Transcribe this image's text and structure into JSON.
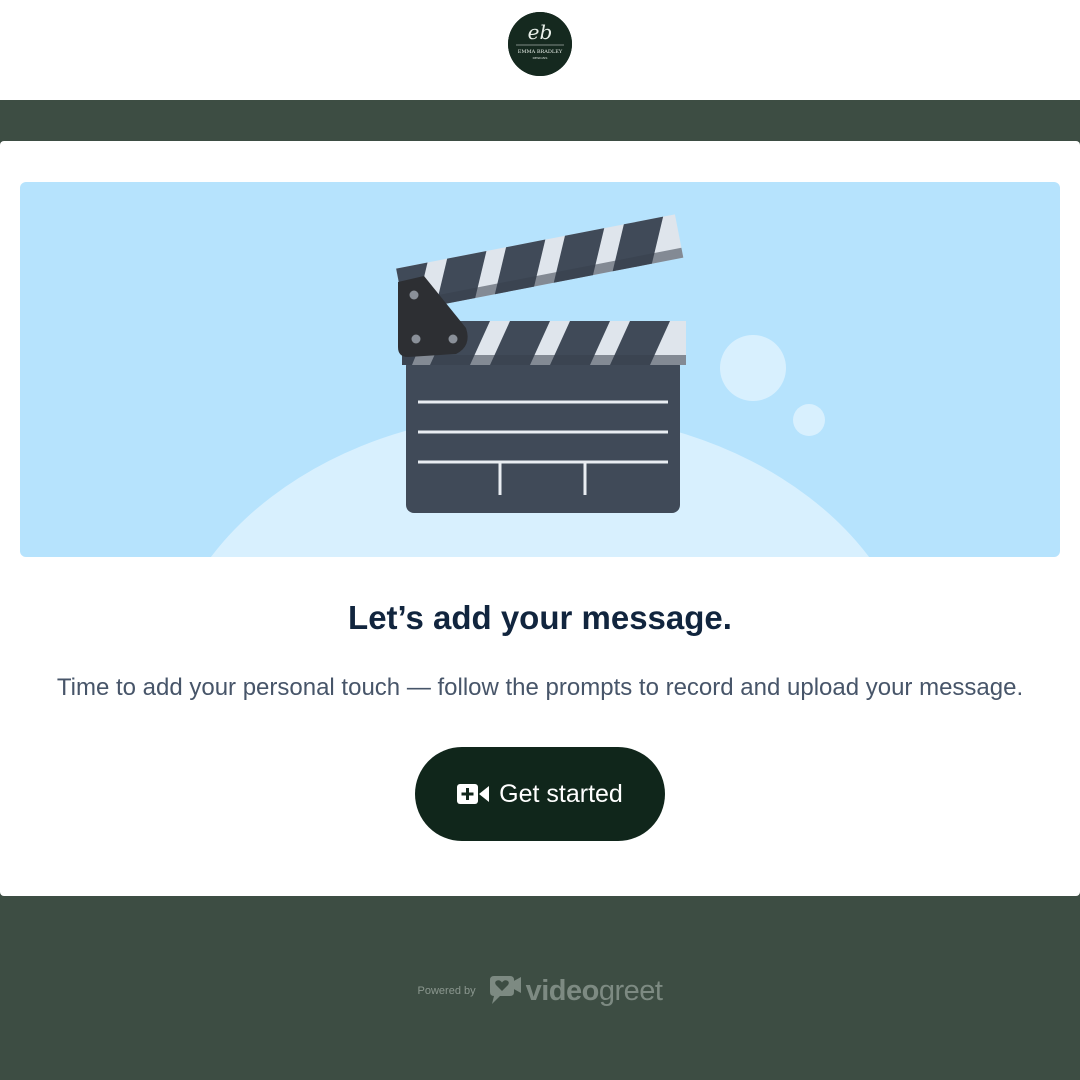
{
  "header": {
    "logo": {
      "initials": "eb",
      "name": "EMMA BRADLEY",
      "tagline": "DESIGNS",
      "bg_color": "#15291f"
    }
  },
  "hero": {
    "illustration": "clapperboard-icon",
    "bg_color": "#b6e3fd"
  },
  "main": {
    "heading": "Let’s add your message.",
    "subtext": "Time to add your personal touch — follow the prompts to record and upload your message.",
    "cta": {
      "label": "Get started",
      "icon": "video-plus-icon",
      "bg_color": "#10261b"
    }
  },
  "footer": {
    "powered_by": "Powered by",
    "brand_bold": "video",
    "brand_light": "greet",
    "brand_icon": "video-chat-heart-icon"
  },
  "theme": {
    "page_bg": "#3d4d43"
  }
}
